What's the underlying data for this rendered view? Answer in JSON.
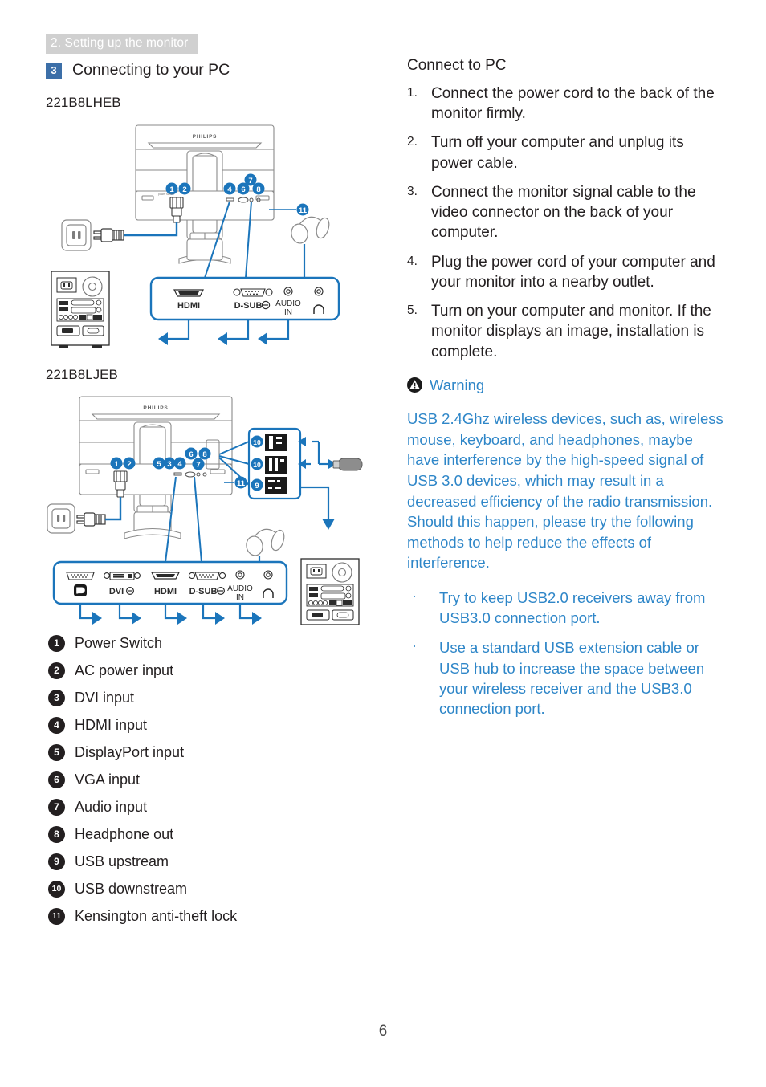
{
  "header": {
    "chapter_band": "2. Setting up the monitor",
    "section_number": "3",
    "section_title": "Connecting to your PC"
  },
  "models": {
    "model1": "221B8LHEB",
    "model2": "221B8LJEB"
  },
  "diagram1": {
    "brand": "PHILIPS",
    "port_labels": [
      "HDMI",
      "D-SUB",
      "AUDIO IN",
      "headphone"
    ],
    "audio_line1": "AUDIO",
    "audio_line2": "IN",
    "hdmi": "HDMI",
    "dsub": "D-SUB",
    "callouts": [
      "1",
      "2",
      "4",
      "6",
      "7",
      "8",
      "11"
    ]
  },
  "diagram2": {
    "brand": "PHILIPS",
    "dp": "DP",
    "dvi": "DVI",
    "hdmi": "HDMI",
    "dsub": "D-SUB",
    "audio_line1": "AUDIO",
    "audio_line2": "IN",
    "callouts": [
      "1",
      "2",
      "5",
      "3",
      "4",
      "6",
      "7",
      "8",
      "9",
      "10",
      "10",
      "11"
    ]
  },
  "legend": [
    {
      "num": "1",
      "label": "Power Switch"
    },
    {
      "num": "2",
      "label": "AC power input"
    },
    {
      "num": "3",
      "label": "DVI input"
    },
    {
      "num": "4",
      "label": "HDMI input"
    },
    {
      "num": "5",
      "label": "DisplayPort input"
    },
    {
      "num": "6",
      "label": "VGA input"
    },
    {
      "num": "7",
      "label": "Audio input"
    },
    {
      "num": "8",
      "label": "Headphone out"
    },
    {
      "num": "9",
      "label": "USB upstream"
    },
    {
      "num": "10",
      "label": "USB downstream"
    },
    {
      "num": "11",
      "label": "Kensington anti-theft lock"
    }
  ],
  "right": {
    "title": "Connect to PC",
    "steps": [
      {
        "num": "1.",
        "text": "Connect the power cord to the back of the monitor firmly."
      },
      {
        "num": "2.",
        "text": "Turn off your computer and unplug its power cable."
      },
      {
        "num": "3.",
        "text": "Connect the monitor signal cable to the video connector on the back of your computer."
      },
      {
        "num": "4.",
        "text": "Plug the power cord of your computer and your monitor into a nearby outlet."
      },
      {
        "num": "5.",
        "text": "Turn on your computer and monitor. If the monitor displays an image, installation is complete."
      }
    ],
    "warning_label": "Warning",
    "warning_body": "USB 2.4Ghz wireless devices, such as, wireless mouse, keyboard, and headphones, maybe have interference by the high-speed signal of USB 3.0 devices, which may result in a decreased efficiency of the radio transmission.  Should this happen, please try the following methods to help reduce the effects of interference.",
    "tips": [
      {
        "bullet": "·",
        "text": "Try to keep USB2.0 receivers away from USB3.0 connection port."
      },
      {
        "bullet": "·",
        "text": "Use a standard USB extension cable or USB hub to increase the space between your wireless receiver and the USB3.0 connection port."
      }
    ]
  },
  "footer": {
    "page_number": "6"
  },
  "colors": {
    "accent_blue": "#2e86c8",
    "badge_blue": "#3c6fa8",
    "band_gray": "#d0d0d0",
    "ink": "#231f20"
  }
}
